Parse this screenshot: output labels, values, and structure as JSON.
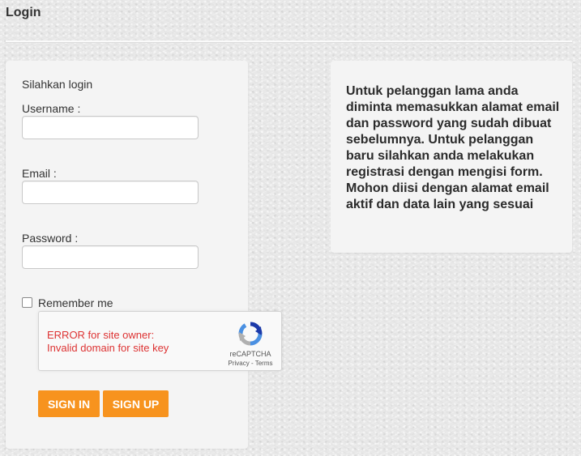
{
  "page": {
    "title": "Login"
  },
  "login_form": {
    "heading": "Silahkan login",
    "username_label": "Username :",
    "username_value": "",
    "email_label": "Email :",
    "email_value": "",
    "password_label": "Password :",
    "password_value": "",
    "remember_label": "Remember me",
    "remember_checked": false,
    "sign_in_label": "SIGN IN",
    "sign_up_label": "SIGN UP"
  },
  "recaptcha": {
    "error_line1": "ERROR for site owner:",
    "error_line2": "Invalid domain for site key",
    "brand": "reCAPTCHA",
    "privacy_label": "Privacy",
    "separator": " - ",
    "terms_label": "Terms",
    "logo_icon": "recaptcha-logo-icon"
  },
  "info": {
    "text": "Untuk pelanggan lama anda diminta memasukkan alamat email dan password yang sudah dibuat sebelumnya. Untuk pelanggan baru silahkan anda melakukan registrasi dengan mengisi form. Mohon diisi dengan alamat email aktif dan data lain yang sesuai"
  },
  "colors": {
    "button_bg": "#f7931e",
    "button_text": "#ffffff",
    "error_text": "#dd3333",
    "panel_bg": "#f4f4f4"
  }
}
